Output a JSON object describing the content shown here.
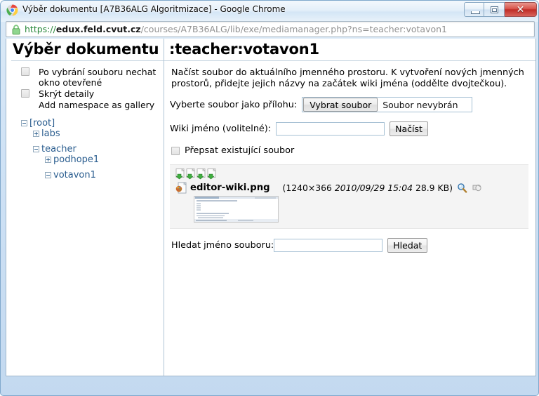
{
  "window": {
    "title": "Výběr dokumentu [A7B36ALG Algoritmizace] - Google Chrome",
    "app_icon": "chrome-logo-icon",
    "minimize_label": "",
    "maximize_label": "",
    "close_label": "✕"
  },
  "addressbar": {
    "lock_icon": "lock-icon",
    "scheme": "https://",
    "host": "edux.feld.cvut.cz",
    "path": "/courses/A7B36ALG/lib/exe/mediamanager.php?ns=teacher:votavon1"
  },
  "sidebar": {
    "title": "Výběr dokumentu",
    "options": [
      {
        "label": "Po vybrání souboru nechat okno otevřené",
        "checked": false,
        "has_checkbox": true
      },
      {
        "label": "Skrýt detaily",
        "checked": false,
        "has_checkbox": true
      },
      {
        "label": "Add namespace as gallery",
        "checked": false,
        "has_checkbox": false
      }
    ],
    "tree": {
      "root": {
        "label": "[root]",
        "state": "expanded"
      },
      "children": [
        {
          "label": "labs",
          "state": "collapsed"
        },
        {
          "label": "teacher",
          "state": "expanded",
          "children": [
            {
              "label": "podhope1",
              "state": "collapsed"
            },
            {
              "label": "votavon1",
              "state": "expanded"
            }
          ]
        }
      ]
    }
  },
  "main": {
    "title": ":teacher:votavon1",
    "intro": "Načíst soubor do aktuálního jmenného prostoru. K vytvoření nových jmenných prostorů, přidejte jejich názvy na začátek wiki jména (oddělte dvojtečkou).",
    "upload": {
      "label": "Vyberte soubor jako přílohu:",
      "button_label": "Vybrat soubor",
      "file_status": "Soubor nevybrán"
    },
    "wikiname": {
      "label": "Wiki jméno (volitelné):",
      "value": "",
      "submit_label": "Načíst"
    },
    "overwrite": {
      "label": "Přepsat existující soubor",
      "checked": false
    },
    "sort_icons": [
      "sort-name-icon",
      "sort-date-icon",
      "sort-size-icon",
      "sort-type-icon"
    ],
    "files": [
      {
        "icon": "image-file-icon",
        "name": "editor-wiki.png",
        "dimensions": "1240×366",
        "date": "2010/09/29",
        "time": "15:04",
        "size": "28.9 KB",
        "meta_open": "(",
        "meta_close": ")",
        "zoom_icon": "magnifier-icon",
        "link_icon": "link-media-icon",
        "thumbnail": "editor-wiki-thumbnail"
      }
    ],
    "search": {
      "label": "Hledat jméno souboru:",
      "value": "",
      "button_label": "Hledat"
    }
  },
  "colors": {
    "link": "#2a5d8f",
    "url_host": "#1a1a1a",
    "url_scheme": "#2c8a3d",
    "filelist_bg": "#f4f4f4",
    "frame": "#c3d9f0"
  }
}
